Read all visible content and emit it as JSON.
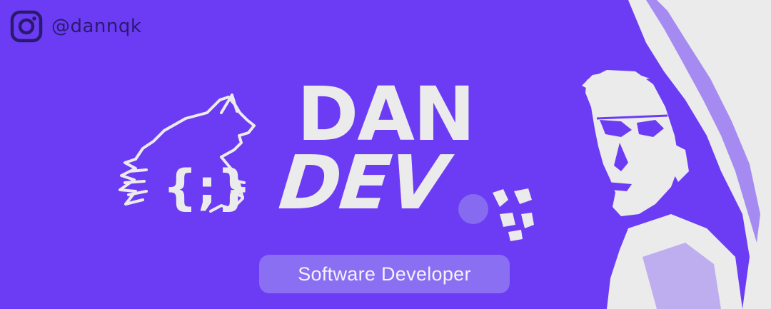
{
  "social": {
    "icon": "instagram-icon",
    "handle": "@dannqk"
  },
  "brand": {
    "line1": "DAN",
    "line2": "DEV",
    "logo_icon": "howling-wolf-braces-icon",
    "logo_text": "{;}"
  },
  "role": {
    "label": "Software Developer"
  },
  "colors": {
    "background": "#6c3cf5",
    "text_light": "#ebebeb",
    "pill": "#8a6ff2",
    "handle": "#2a1a6e"
  }
}
